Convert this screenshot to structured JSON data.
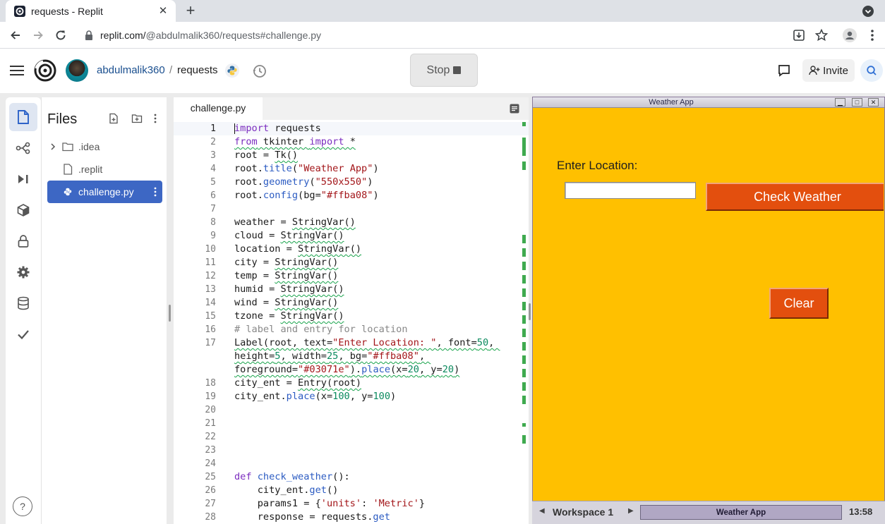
{
  "browser": {
    "tab_title": "requests - Replit",
    "new_tab": "+",
    "close_tab": "✕",
    "url_host": "replit.com/",
    "url_path": "@abdulmalik360/requests#challenge.py"
  },
  "header": {
    "username": "abdulmalik360",
    "separator": "/",
    "repl_name": "requests",
    "stop_label": "Stop",
    "invite_label": "Invite"
  },
  "sidebar": {
    "help": "?"
  },
  "files": {
    "title": "Files",
    "items": [
      {
        "name": ".idea",
        "type": "folder"
      },
      {
        "name": ".replit",
        "type": "file"
      },
      {
        "name": "challenge.py",
        "type": "python",
        "selected": true
      }
    ]
  },
  "editor": {
    "tab": "challenge.py",
    "lines": [
      {
        "n": "1",
        "html": "<span class=\"kw\">import</span> requests"
      },
      {
        "n": "2",
        "html": "<span class=\"kw sq\">from</span><span class=\"sq\"> tkinter </span><span class=\"kw sq\">import</span><span class=\"sq\"> *</span>"
      },
      {
        "n": "3",
        "html": "root = <span class=\"sq\">Tk()</span>"
      },
      {
        "n": "4",
        "html": "root.<span class=\"fn\">title</span>(<span class=\"str\">\"Weather App\"</span>)"
      },
      {
        "n": "5",
        "html": "root.<span class=\"fn\">geometry</span>(<span class=\"str\">\"550x550\"</span>)"
      },
      {
        "n": "6",
        "html": "root.<span class=\"fn\">config</span>(bg=<span class=\"str\">\"#ffba08\"</span>)"
      },
      {
        "n": "7",
        "html": ""
      },
      {
        "n": "8",
        "html": "weather = <span class=\"sq\">StringVar()</span>"
      },
      {
        "n": "9",
        "html": "cloud = <span class=\"sq\">StringVar()</span>"
      },
      {
        "n": "10",
        "html": "location = <span class=\"sq\">StringVar()</span>"
      },
      {
        "n": "11",
        "html": "city = <span class=\"sq\">StringVar()</span>"
      },
      {
        "n": "12",
        "html": "temp = <span class=\"sq\">StringVar()</span>"
      },
      {
        "n": "13",
        "html": "humid = <span class=\"sq\">StringVar()</span>"
      },
      {
        "n": "14",
        "html": "wind = <span class=\"sq\">StringVar()</span>"
      },
      {
        "n": "15",
        "html": "tzone = <span class=\"sq\">StringVar()</span>"
      },
      {
        "n": "16",
        "html": "<span class=\"cm\"># label and entry for location</span>"
      },
      {
        "n": "17",
        "html": "<span class=\"sq\">Label(root, text=</span><span class=\"str sq\">\"Enter Location: \"</span><span class=\"sq\">, font=</span><span class=\"num sq\">50</span><span class=\"sq\">, </span>"
      },
      {
        "n": "",
        "html": "<span class=\"sq\">height=</span><span class=\"num sq\">5</span><span class=\"sq\">, width=</span><span class=\"num sq\">25</span><span class=\"sq\">, bg=</span><span class=\"str sq\">\"#ffba08\"</span><span class=\"sq\">, </span>"
      },
      {
        "n": "",
        "html": "<span class=\"sq\">foreground=</span><span class=\"str sq\">\"#03071e\"</span><span class=\"sq\">).</span><span class=\"fn sq\">place</span><span class=\"sq\">(x=</span><span class=\"num sq\">20</span><span class=\"sq\">, y=</span><span class=\"num sq\">20</span><span class=\"sq\">)</span>"
      },
      {
        "n": "18",
        "html": "city_ent = <span class=\"sq\">Entry(root)</span>"
      },
      {
        "n": "19",
        "html": "city_ent.<span class=\"fn\">place</span>(x=<span class=\"num\">100</span>, y=<span class=\"num\">100</span>)"
      },
      {
        "n": "20",
        "html": ""
      },
      {
        "n": "21",
        "html": ""
      },
      {
        "n": "22",
        "html": ""
      },
      {
        "n": "23",
        "html": ""
      },
      {
        "n": "24",
        "html": ""
      },
      {
        "n": "25",
        "html": "<span class=\"kw\">def</span> <span class=\"fn\">check_weather</span>():"
      },
      {
        "n": "26",
        "html": "    city_ent.<span class=\"fn\">get</span>()"
      },
      {
        "n": "27",
        "html": "    params1 = {<span class=\"str\">'units'</span>: <span class=\"str\">'Metric'</span>}"
      },
      {
        "n": "28",
        "html": "    response = requests.<span class=\"fn\">get</span>"
      }
    ]
  },
  "tk_window": {
    "title": "Weather App",
    "label": "Enter Location:",
    "entry_value": "",
    "check_button": "Check Weather",
    "clear_button": "Clear",
    "bg_color": "#ffc000",
    "button_color": "#e34f0e"
  },
  "taskbar": {
    "workspace": "Workspace 1",
    "app": "Weather App",
    "clock": "13:58"
  }
}
